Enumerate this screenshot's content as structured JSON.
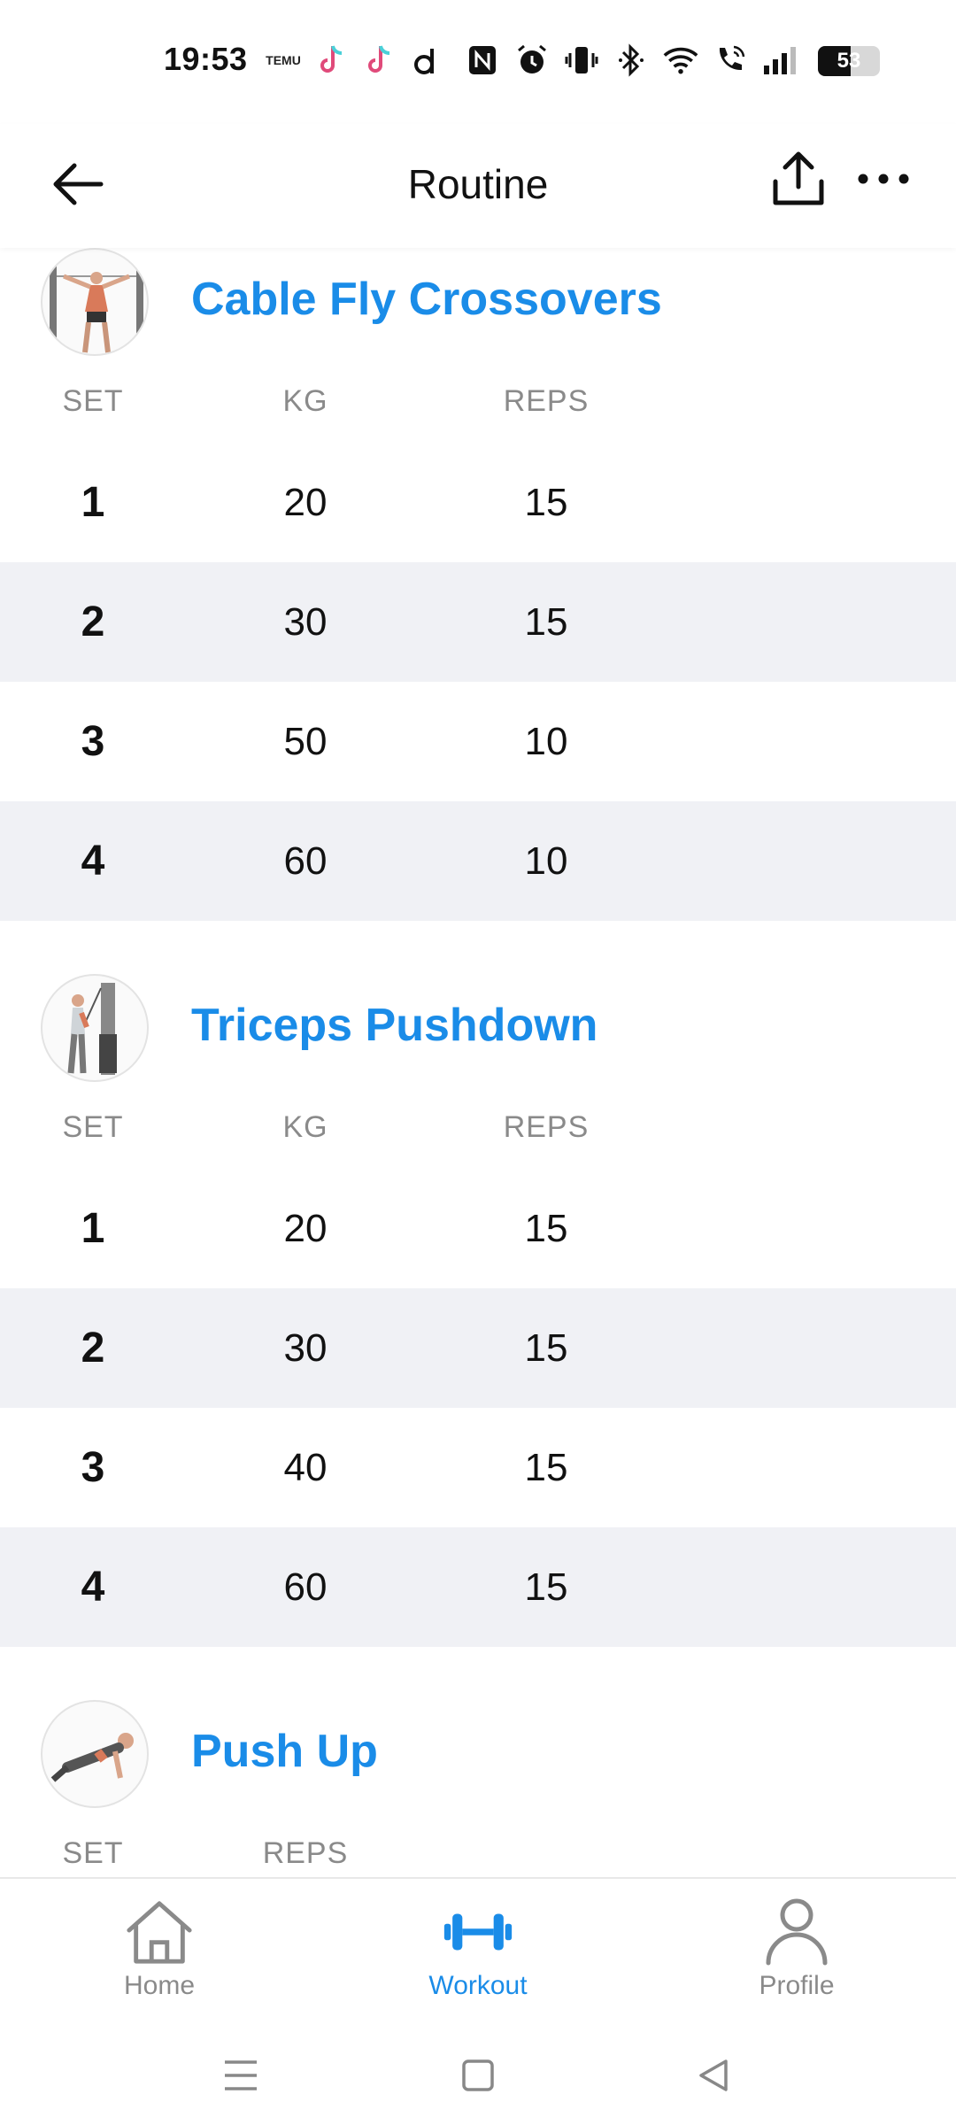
{
  "status_bar": {
    "time": "19:53",
    "temu_label": "TEMU",
    "battery_level": "53",
    "battery_fraction": 0.53,
    "icons": [
      "temu-icon",
      "tiktok-icon",
      "tiktok-icon",
      "d-app-icon",
      "nfc-icon",
      "alarm-icon",
      "vibrate-icon",
      "bluetooth-icon",
      "wifi-icon",
      "wifi-call-icon",
      "signal-icon",
      "battery-icon"
    ]
  },
  "header": {
    "title": "Routine",
    "back_icon": "arrow-left-icon",
    "share_icon": "share-upload-icon",
    "more_icon": "more-horizontal-icon"
  },
  "exercises": [
    {
      "name": "Cable Fly Crossovers",
      "columns": [
        "SET",
        "KG",
        "REPS"
      ],
      "rows": [
        {
          "set": "1",
          "kg": "20",
          "reps": "15"
        },
        {
          "set": "2",
          "kg": "30",
          "reps": "15"
        },
        {
          "set": "3",
          "kg": "50",
          "reps": "10"
        },
        {
          "set": "4",
          "kg": "60",
          "reps": "10"
        }
      ]
    },
    {
      "name": "Triceps Pushdown",
      "columns": [
        "SET",
        "KG",
        "REPS"
      ],
      "rows": [
        {
          "set": "1",
          "kg": "20",
          "reps": "15"
        },
        {
          "set": "2",
          "kg": "30",
          "reps": "15"
        },
        {
          "set": "3",
          "kg": "40",
          "reps": "15"
        },
        {
          "set": "4",
          "kg": "60",
          "reps": "15"
        }
      ]
    },
    {
      "name": "Push Up",
      "columns": [
        "SET",
        "REPS"
      ]
    }
  ],
  "bottom_nav": {
    "items": [
      {
        "label": "Home",
        "icon": "home-icon",
        "active": false
      },
      {
        "label": "Workout",
        "icon": "dumbbell-icon",
        "active": true
      },
      {
        "label": "Profile",
        "icon": "profile-icon",
        "active": false
      }
    ]
  },
  "colors": {
    "accent": "#1a8ce8",
    "row_alt": "#f0f1f5",
    "muted": "#8a8a8a"
  }
}
